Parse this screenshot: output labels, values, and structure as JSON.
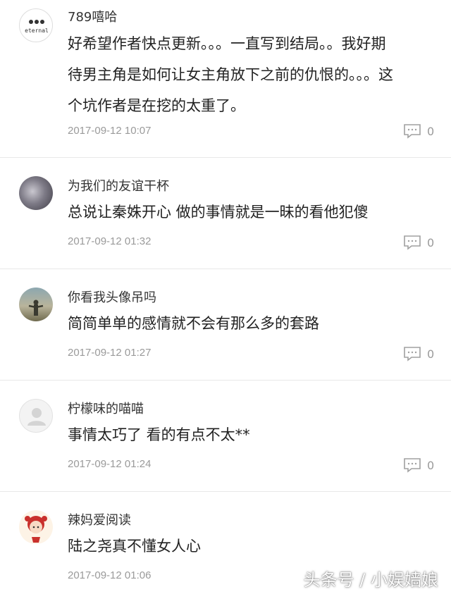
{
  "comments": [
    {
      "user": "789嘻哈",
      "avatar": "eternal-avatar",
      "avatar_text": "eternal",
      "lines": [
        "好希望作者快点更新。。。一直写到结局。。我好期",
        "待男主角是如何让女主角放下之前的仇恨的。。。这",
        "个坑作者是在挖的太重了。"
      ],
      "time": "2017-09-12 10:07",
      "replies": "0"
    },
    {
      "user": "为我们的友谊干杯",
      "avatar": "photo-avatar",
      "lines": [
        "总说让秦姝开心 做的事情就是一昧的看他犯傻"
      ],
      "time": "2017-09-12 01:32",
      "replies": "0"
    },
    {
      "user": "你看我头像吊吗",
      "avatar": "sunset-avatar",
      "lines": [
        "简简单单的感情就不会有那么多的套路"
      ],
      "time": "2017-09-12 01:27",
      "replies": "0"
    },
    {
      "user": "柠檬味的喵喵",
      "avatar": "default-avatar",
      "lines": [
        "事情太巧了 看的有点不太**"
      ],
      "time": "2017-09-12 01:24",
      "replies": "0"
    },
    {
      "user": "辣妈爱阅读",
      "avatar": "cartoon-girl-avatar",
      "lines": [
        "陆之尧真不懂女人心"
      ],
      "time": "2017-09-12 01:06",
      "replies": "0"
    }
  ],
  "watermark": "头条号 / 小娱嫱娘",
  "colors": {
    "meta": "#9a9a9a",
    "divider": "#e8e8e8"
  }
}
